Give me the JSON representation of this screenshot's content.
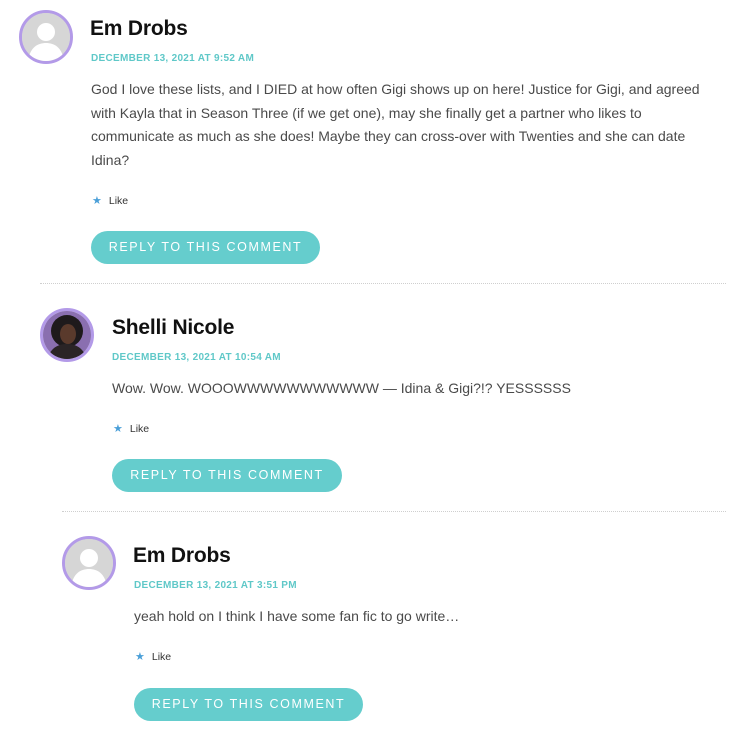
{
  "comments": [
    {
      "author": "Em Drobs",
      "date": "DECEMBER 13, 2021 AT 9:52 AM",
      "text": "God I love these lists, and I DIED at how often Gigi shows up on here! Justice for Gigi, and agreed with Kayla that in Season Three (if we get one), may she finally get a partner who likes to communicate as much as she does! Maybe they can cross-over with Twenties and she can date Idina?",
      "like_label": "Like",
      "reply_label": "REPLY TO THIS COMMENT"
    },
    {
      "author": "Shelli Nicole",
      "date": "DECEMBER 13, 2021 AT 10:54 AM",
      "text": "Wow. Wow. WOOOWWWWWWWWWWW — Idina & Gigi?!? YESSSSSS",
      "like_label": "Like",
      "reply_label": "REPLY TO THIS COMMENT"
    },
    {
      "author": "Em Drobs",
      "date": "DECEMBER 13, 2021 AT 3:51 PM",
      "text": "yeah hold on I think I have some fan fic to go write…",
      "like_label": "Like",
      "reply_label": "REPLY TO THIS COMMENT"
    }
  ],
  "colors": {
    "accent": "#65cdcd",
    "date": "#5fc8c8",
    "avatar_ring": "#b39ae8",
    "star": "#4a9fd8"
  },
  "icons": {
    "default_avatar": "default-person-avatar",
    "like": "star-icon"
  }
}
